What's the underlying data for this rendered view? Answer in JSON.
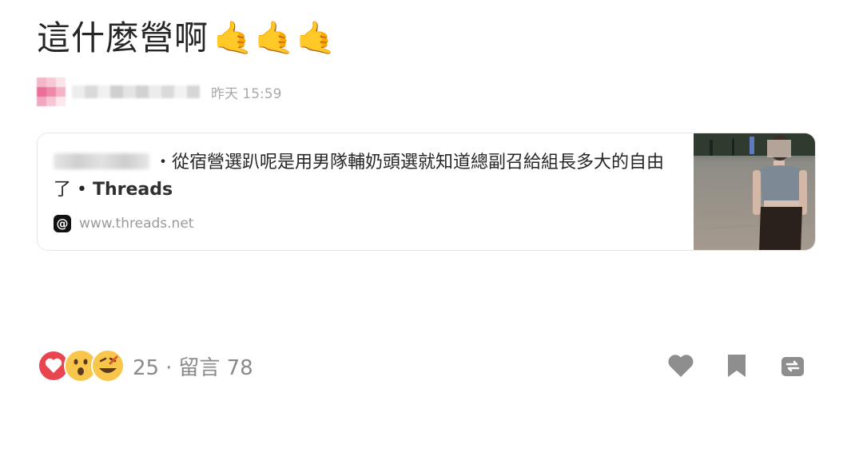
{
  "post": {
    "title": "這什麼營啊",
    "title_emojis": [
      "🤙",
      "🤙",
      "🤙"
    ],
    "timestamp": "昨天 15:59"
  },
  "link_preview": {
    "title_suffix": "・從宿營選趴呢是用男隊輔奶頭選就知道總副召給組長多大的自由了 • ",
    "site_name": "Threads",
    "domain": "www.threads.net",
    "logo_icon": "threads-logo-icon"
  },
  "stats": {
    "reactions": [
      "heart-reaction-icon",
      "wow-reaction-icon",
      "haha-reaction-icon"
    ],
    "reaction_count": "25",
    "separator": "·",
    "comments_label": "留言 78"
  },
  "actions": {
    "like_icon": "heart-icon",
    "save_icon": "bookmark-icon",
    "share_icon": "repost-icon"
  },
  "colors": {
    "heart_red": "#e8454f",
    "emoji_yellow": "#f7c64b",
    "action_gray": "#8e8e8e"
  }
}
